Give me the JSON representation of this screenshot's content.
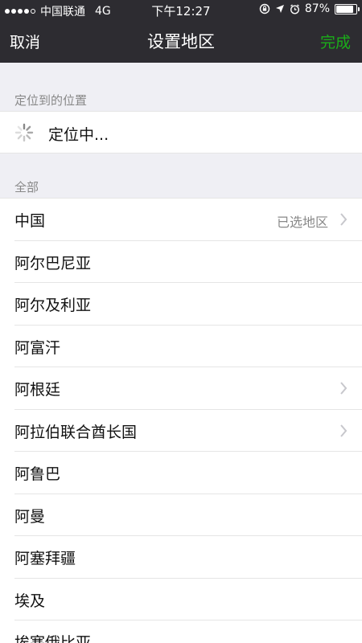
{
  "status": {
    "carrier": "中国联通",
    "network": "4G",
    "time": "下午12:27",
    "battery": "87%",
    "battery_level": 0.87
  },
  "nav": {
    "cancel": "取消",
    "title": "设置地区",
    "done": "完成"
  },
  "location_section": {
    "header": "定位到的位置",
    "status_text": "定位中..."
  },
  "all_section": {
    "header": "全部",
    "rows": [
      {
        "label": "中国",
        "note": "已选地区",
        "chevron": true
      },
      {
        "label": "阿尔巴尼亚",
        "note": "",
        "chevron": false
      },
      {
        "label": "阿尔及利亚",
        "note": "",
        "chevron": false
      },
      {
        "label": "阿富汗",
        "note": "",
        "chevron": false
      },
      {
        "label": "阿根廷",
        "note": "",
        "chevron": true
      },
      {
        "label": "阿拉伯联合酋长国",
        "note": "",
        "chevron": true
      },
      {
        "label": "阿鲁巴",
        "note": "",
        "chevron": false
      },
      {
        "label": "阿曼",
        "note": "",
        "chevron": false
      },
      {
        "label": "阿塞拜疆",
        "note": "",
        "chevron": false
      },
      {
        "label": "埃及",
        "note": "",
        "chevron": false
      },
      {
        "label": "埃塞俄比亚",
        "note": "",
        "chevron": false
      }
    ]
  },
  "colors": {
    "topbar": "#2d2c31",
    "accent": "#1aad19",
    "background": "#efeff4"
  }
}
